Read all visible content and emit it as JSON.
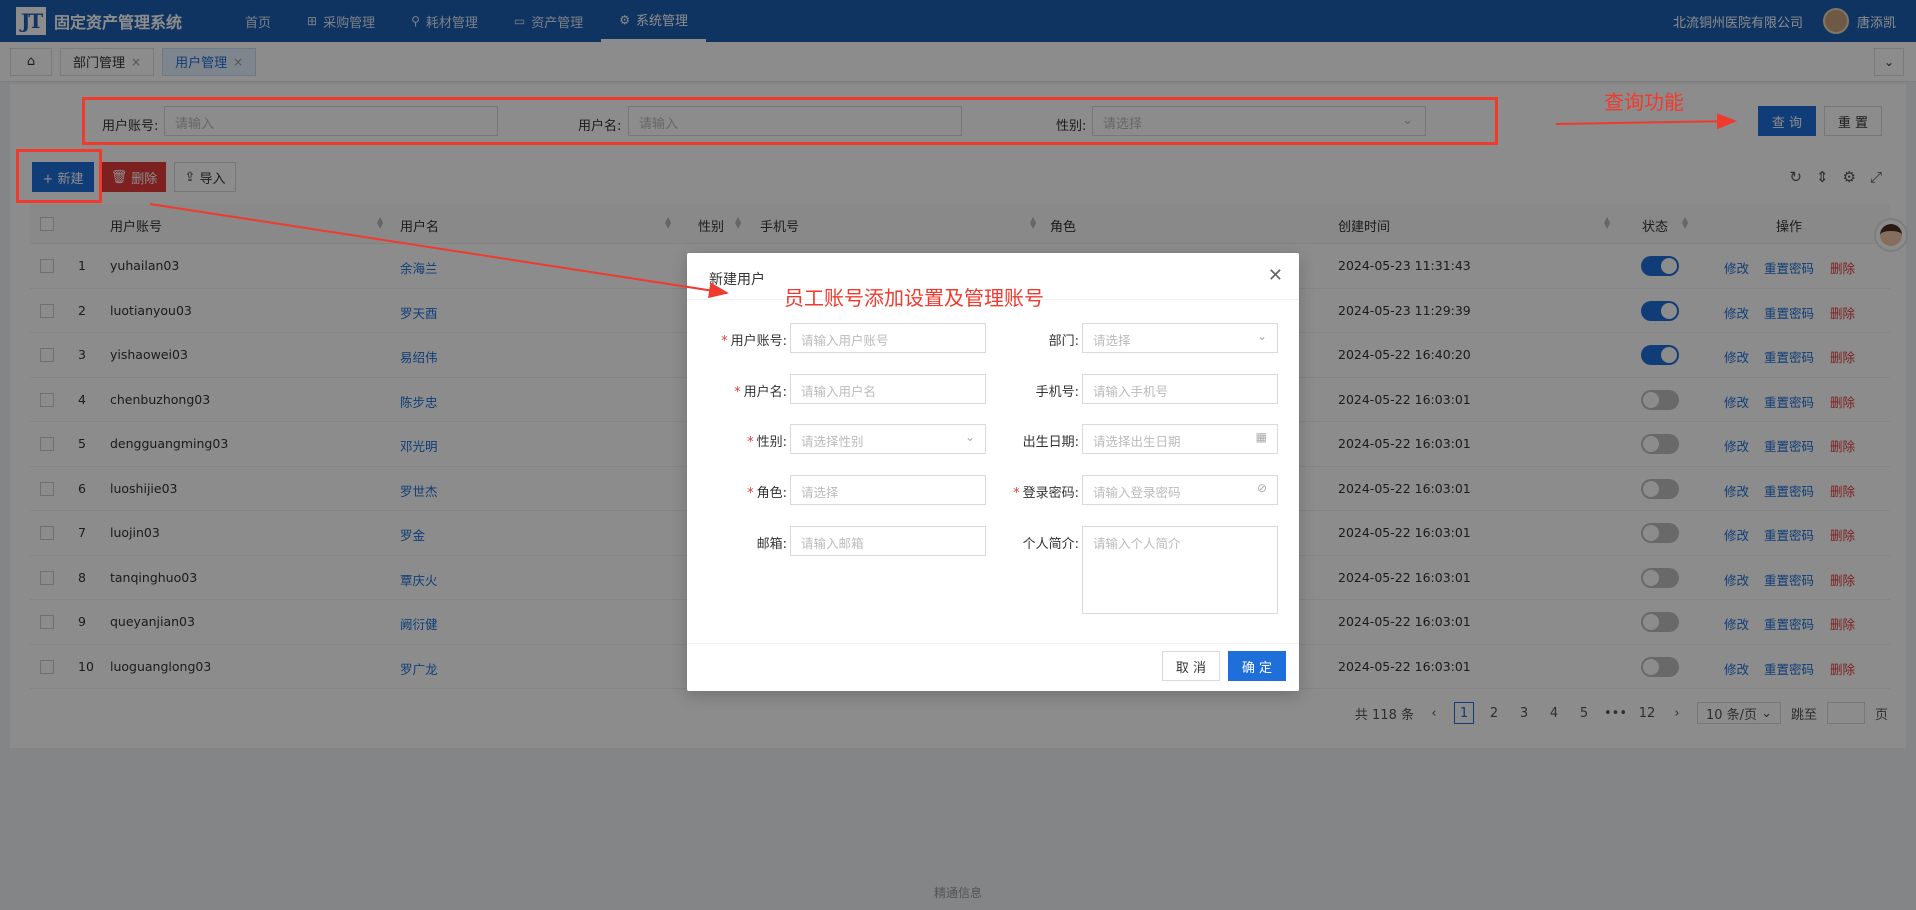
{
  "app": {
    "logo_mark": "JT",
    "title": "固定资产管理系统",
    "org": "北流铜州医院有限公司",
    "user": "唐添凯",
    "footer": "精通信息"
  },
  "nav": [
    "首页",
    "采购管理",
    "耗材管理",
    "资产管理",
    "系统管理"
  ],
  "tabs": [
    {
      "label": "部门管理",
      "close": "×"
    },
    {
      "label": "用户管理",
      "close": "×"
    }
  ],
  "search": {
    "account_label": "用户账号:",
    "account_placeholder": "请输入",
    "name_label": "用户名:",
    "name_placeholder": "请输入",
    "gender_label": "性别:",
    "gender_placeholder": "请选择",
    "query_btn": "查 询",
    "reset_btn": "重 置"
  },
  "toolbar": {
    "new_btn": "+ 新建",
    "delete_btn": "删除",
    "import_btn": "导入"
  },
  "table": {
    "columns": [
      "用户账号",
      "用户名",
      "性别",
      "手机号",
      "角色",
      "创建时间",
      "状态",
      "操作"
    ],
    "actions": {
      "edit": "修改",
      "reset_pwd": "重置密码",
      "delete": "删除"
    },
    "rows": [
      {
        "no": "1",
        "account": "yuhailan03",
        "name": "余海兰",
        "created": "2024-05-23 11:31:43",
        "enabled": true
      },
      {
        "no": "2",
        "account": "luotianyou03",
        "name": "罗天酉",
        "created": "2024-05-23 11:29:39",
        "enabled": true
      },
      {
        "no": "3",
        "account": "yishaowei03",
        "name": "易绍伟",
        "created": "2024-05-22 16:40:20",
        "enabled": true
      },
      {
        "no": "4",
        "account": "chenbuzhong03",
        "name": "陈步忠",
        "created": "2024-05-22 16:03:01",
        "enabled": false
      },
      {
        "no": "5",
        "account": "dengguangming03",
        "name": "邓光明",
        "created": "2024-05-22 16:03:01",
        "enabled": false
      },
      {
        "no": "6",
        "account": "luoshijie03",
        "name": "罗世杰",
        "created": "2024-05-22 16:03:01",
        "enabled": false
      },
      {
        "no": "7",
        "account": "luojin03",
        "name": "罗金",
        "created": "2024-05-22 16:03:01",
        "enabled": false
      },
      {
        "no": "8",
        "account": "tanqinghuo03",
        "name": "覃庆火",
        "created": "2024-05-22 16:03:01",
        "enabled": false
      },
      {
        "no": "9",
        "account": "queyanjian03",
        "name": "阙衍健",
        "created": "2024-05-22 16:03:01",
        "enabled": false
      },
      {
        "no": "10",
        "account": "luoguanglong03",
        "name": "罗广龙",
        "created": "2024-05-22 16:03:01",
        "enabled": false
      }
    ]
  },
  "pagination": {
    "total": "共 118 条",
    "pages": [
      "1",
      "2",
      "3",
      "4",
      "5",
      "•••",
      "12"
    ],
    "current_page": 1,
    "page_size": "10 条/页",
    "jump_label": "跳至",
    "page_suffix": "页"
  },
  "modal": {
    "title": "新建用户",
    "fields": {
      "account": {
        "label": "用户账号:",
        "placeholder": "请输入用户账号"
      },
      "dept": {
        "label": "部门:",
        "placeholder": "请选择"
      },
      "name": {
        "label": "用户名:",
        "placeholder": "请输入用户名"
      },
      "phone": {
        "label": "手机号:",
        "placeholder": "请输入手机号"
      },
      "gender": {
        "label": "性别:",
        "placeholder": "请选择性别"
      },
      "birthday": {
        "label": "出生日期:",
        "placeholder": "请选择出生日期"
      },
      "role": {
        "label": "角色:",
        "placeholder": "请选择"
      },
      "password": {
        "label": "登录密码:",
        "placeholder": "请输入登录密码"
      },
      "email": {
        "label": "邮箱:",
        "placeholder": "请输入邮箱"
      },
      "bio": {
        "label": "个人简介:",
        "placeholder": "请输入个人简介"
      }
    },
    "cancel_btn": "取 消",
    "ok_btn": "确 定"
  },
  "annotations": {
    "query": "查询功能",
    "add": "员工账号添加设置及管理账号"
  }
}
